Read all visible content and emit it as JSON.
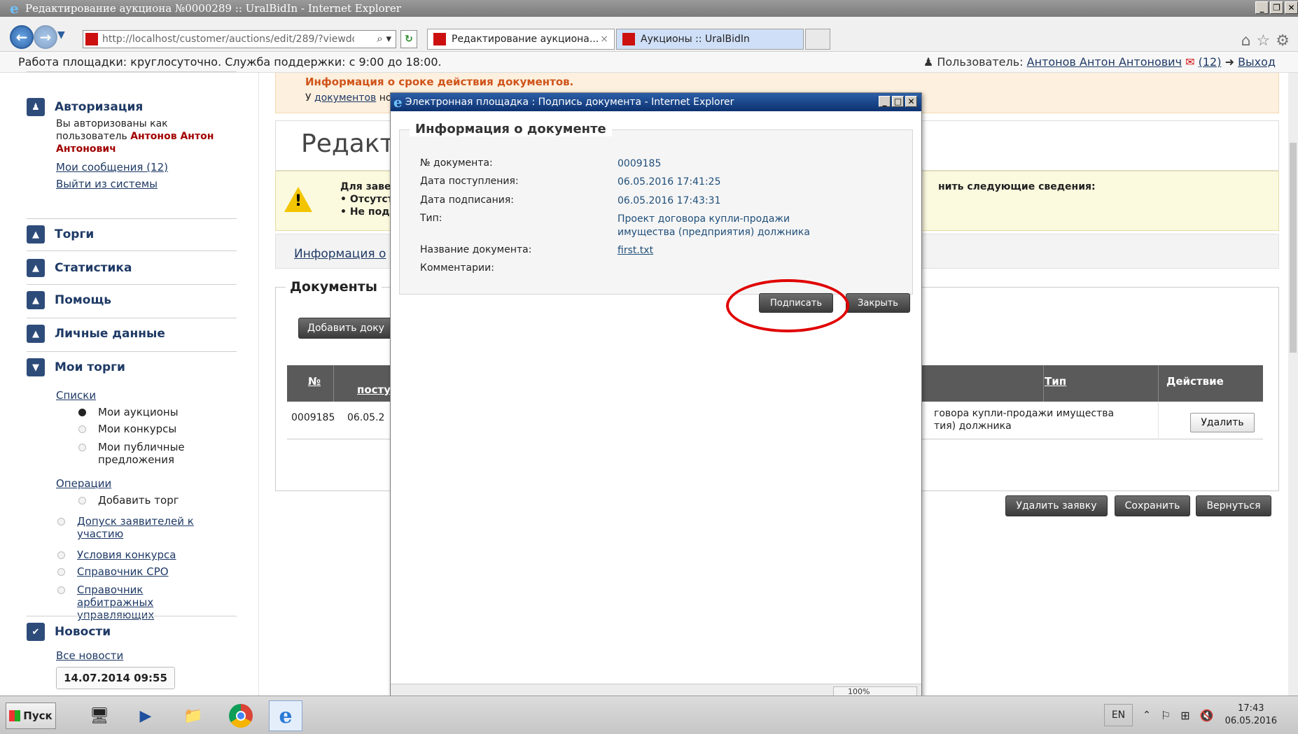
{
  "browser": {
    "title": "Редактирование аукциона №0000289 :: UralBidIn - Internet Explorer",
    "address": "http://localhost/customer/auctions/edit/289/?viewdocs=",
    "tabs": [
      {
        "label": "Редактирование аукциона...",
        "close": "×"
      },
      {
        "label": "Аукционы :: UralBidIn"
      }
    ]
  },
  "site_bar": {
    "work_hours": "Работа площадки: круглосуточно. Служба поддержки: с 9:00 до 18:00.",
    "user_label": "Пользователь:",
    "user_name": "Антонов Антон Антонович",
    "messages_count": "(12)",
    "logout": "Выход"
  },
  "sidebar": {
    "auth": {
      "title": "Авторизация",
      "text1": "Вы авторизованы как",
      "text2": "пользователь",
      "user_name": "Антонов Антон Антонович",
      "messages": "Мои сообщения (12)",
      "logout": "Выйти из системы"
    },
    "sections": {
      "torgi": "Торги",
      "stats": "Статистика",
      "help": "Помощь",
      "personal": "Личные данные",
      "my_torgi": "Мои торги"
    },
    "lists_label": "Списки",
    "lists": [
      "Мои аукционы",
      "Мои конкурсы",
      "Мои публичные предложения"
    ],
    "operations_label": "Операции",
    "add_torg": "Добавить торг",
    "operations": [
      "Допуск заявителей к участию",
      "Условия конкурса",
      "Справочник СРО",
      "Справочник арбитражных управляющих"
    ],
    "news": {
      "title": "Новости",
      "all": "Все новости",
      "date": "14.07.2014 09:55"
    }
  },
  "main": {
    "alert_title": "Информация о сроке действия документов.",
    "alert_text_prefix": "У",
    "alert_text_link": "документов",
    "alert_text_rest": "ном",
    "page_title": "Редакт",
    "warning_line1_left": "Для завер",
    "warning_line1_right": "нить следующие сведения:",
    "warning_bullet1": "• Отсутств",
    "warning_bullet2": "• Не подпи",
    "tab_info": "Информация о",
    "docs_title": "Документы",
    "add_doc_button": "Добавить доку",
    "table": {
      "col_num": "№",
      "col_date": "поступ",
      "col_type": "Тип",
      "col_action": "Действие",
      "row": {
        "num": "0009185",
        "date": "06.05.2",
        "type_line1": "говора купли-продажи имущества",
        "type_line2": "тия) должника",
        "delete": "Удалить"
      }
    },
    "buttons": {
      "delete_application": "Удалить заявку",
      "save": "Сохранить",
      "back": "Вернуться"
    }
  },
  "dialog": {
    "title": "Электронная площадка : Подпись документа - Internet Explorer",
    "section_title": "Информация о документе",
    "labels": {
      "number": "№ документа:",
      "received": "Дата поступления:",
      "signed": "Дата подписания:",
      "type": "Тип:",
      "name": "Название документа:",
      "comments": "Комментарии:"
    },
    "values": {
      "number": "0009185",
      "received": "06.05.2016 17:41:25",
      "signed": "06.05.2016 17:43:31",
      "type_line1": "Проект договора купли-продажи",
      "type_line2": "имущества (предприятия) должника",
      "name": "first.txt"
    },
    "sign_button": "Подписать",
    "close_button": "Закрыть",
    "zoom": "100%"
  },
  "taskbar": {
    "start": "Пуск",
    "lang": "EN",
    "time": "17:43",
    "date": "06.05.2016"
  },
  "colors": {
    "accent": "#1f3a66",
    "highlight_circle": "#e00000"
  }
}
